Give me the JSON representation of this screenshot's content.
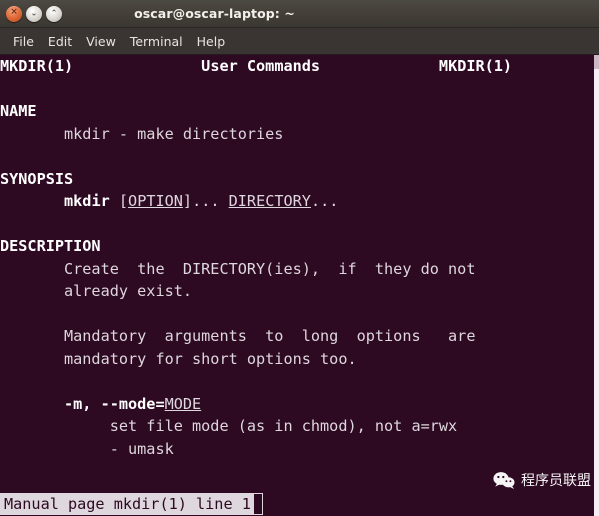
{
  "window": {
    "title": "oscar@oscar-laptop: ~",
    "controls": [
      {
        "name": "close",
        "glyph": "✕"
      },
      {
        "name": "minimize",
        "glyph": "⌄"
      },
      {
        "name": "maximize",
        "glyph": "⌃"
      }
    ]
  },
  "menubar": {
    "items": [
      "File",
      "Edit",
      "View",
      "Terminal",
      "Help"
    ]
  },
  "terminal": {
    "background_color": "#2d0922",
    "foreground_color": "#ded7dd",
    "manpage": {
      "header": {
        "left": "MKDIR(1)",
        "center": "User Commands",
        "right": "MKDIR(1)"
      },
      "sections": [
        {
          "heading": "NAME",
          "body": "mkdir - make directories"
        },
        {
          "heading": "SYNOPSIS",
          "body": "mkdir [OPTION]... DIRECTORY..."
        },
        {
          "heading": "DESCRIPTION",
          "body": "Create  the  DIRECTORY(ies),  if  they do not already exist."
        }
      ],
      "lines": {
        "header_left": "MKDIR(1)",
        "header_center": "User Commands",
        "header_right": "MKDIR(1)",
        "name_heading": "NAME",
        "name_body": "       mkdir - make directories",
        "synopsis_heading": "SYNOPSIS",
        "synopsis_cmd": "mkdir ",
        "synopsis_bracket_open": "[",
        "synopsis_option": "OPTION",
        "synopsis_bracket_close": "]... ",
        "synopsis_directory": "DIRECTORY",
        "synopsis_tail": "...",
        "description_heading": "DESCRIPTION",
        "description_line1": "       Create  the  DIRECTORY(ies),  if  they do not",
        "description_line2": "       already exist.",
        "mandatory_line1": "       Mandatory  arguments  to  long  options   are",
        "mandatory_line2": "       mandatory for short options too.",
        "option_flag": "-m, --mode=",
        "option_arg": "MODE",
        "option_desc1": "            set file mode (as in chmod), not a=rwx",
        "option_desc2": "            - umask"
      }
    }
  },
  "statusbar": {
    "text": "Manual page mkdir(1) line 1"
  },
  "watermark": {
    "label": "程序员联盟",
    "icon": "wechat-icon"
  }
}
